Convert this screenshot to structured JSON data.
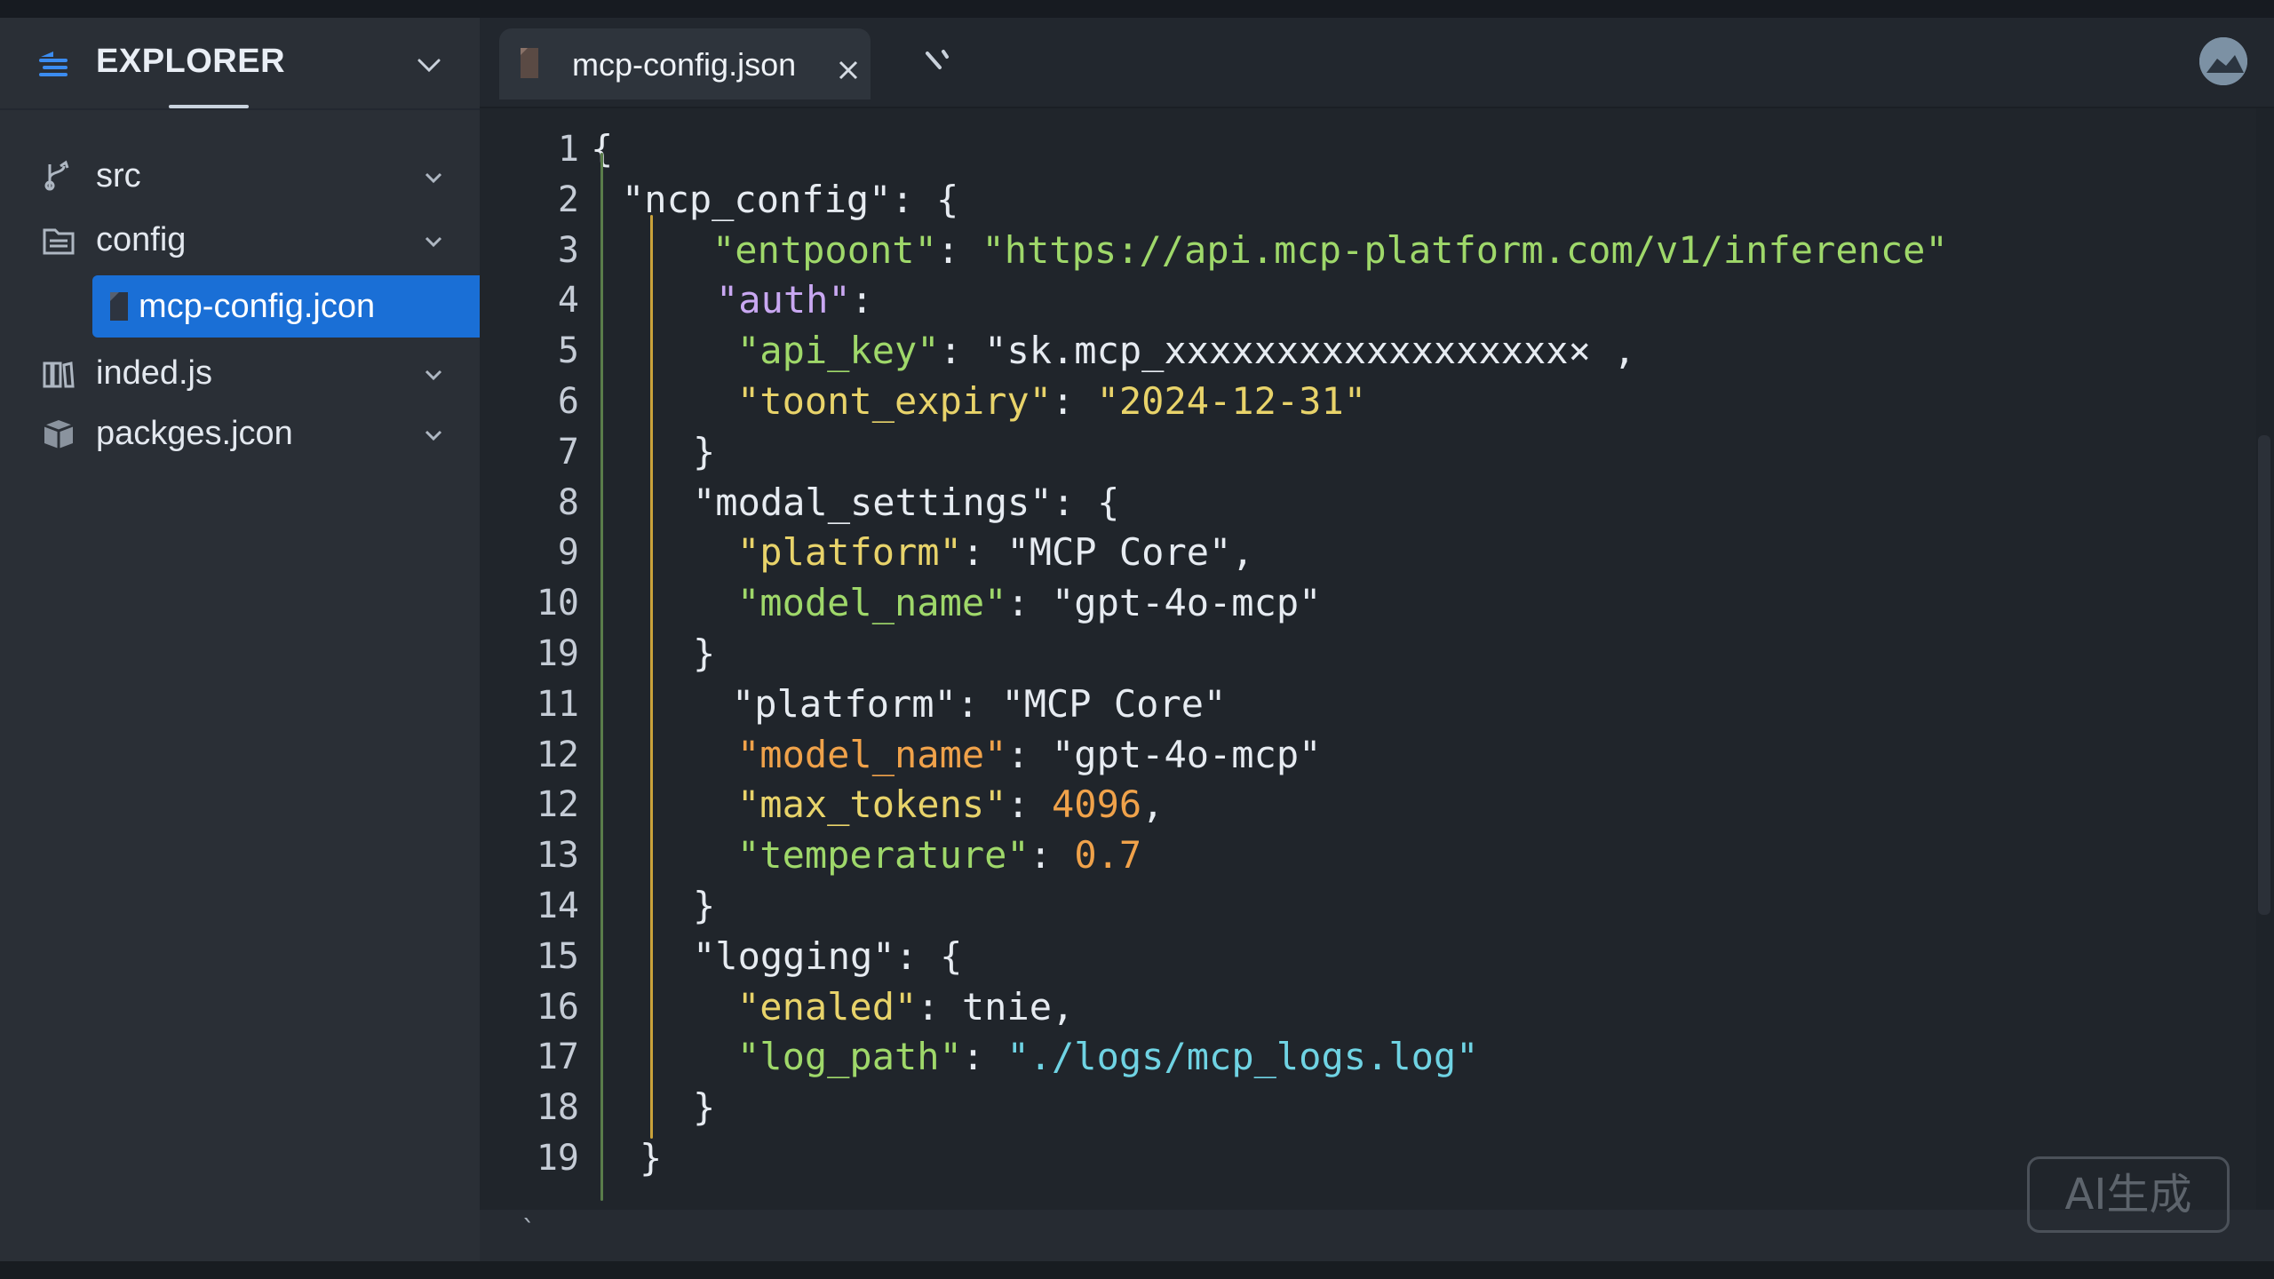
{
  "sidebar": {
    "title": "EXPLORER",
    "items": [
      {
        "label": "src",
        "icon": "git-branch-icon"
      },
      {
        "label": "config",
        "icon": "folder-icon"
      },
      {
        "label": "mcp-config.jcon",
        "icon": "file-icon",
        "active": true
      },
      {
        "label": "inded.js",
        "icon": "library-icon"
      },
      {
        "label": "packges.jcon",
        "icon": "package-icon"
      }
    ]
  },
  "tabs": [
    {
      "label": "mcp-config.json",
      "icon": "file-icon",
      "close": "close-icon"
    }
  ],
  "editor": {
    "line_numbers": [
      "1",
      "2",
      "3",
      "4",
      "5",
      "6",
      "7",
      "8",
      "9",
      "10",
      "19",
      "11",
      "12",
      "12",
      "13",
      "14",
      "15",
      "16",
      "17",
      "18",
      "19"
    ],
    "lines": [
      [
        "{"
      ],
      [
        "\"ncp_config\": {"
      ],
      [
        "\"entpoont\"",
        ": ",
        "\"https://api.mcp-platform.com/v1/inference\""
      ],
      [
        "\"auth\"",
        ":"
      ],
      [
        "\"api_key\"",
        ": ",
        "\"sk.mcp_xxxxxxxxxxxxxxxxxx× ,"
      ],
      [
        "\"toont_expiry\"",
        ": ",
        "\"2024-12-31\""
      ],
      [
        "}"
      ],
      [
        "\"modal_settings\": {"
      ],
      [
        "\"platform\"",
        ": ",
        "\"MCP Core\","
      ],
      [
        "\"model_name\"",
        ": ",
        "\"gpt-4o-mcp\""
      ],
      [
        "}"
      ],
      [
        "\"platform\"",
        ": ",
        "\"MCP Core\""
      ],
      [
        "\"model_name\"",
        ": ",
        "\"gpt-4o-mcp\""
      ],
      [
        "\"max_tokens\"",
        ": ",
        "4096",
        ","
      ],
      [
        "\"temperature\"",
        ": ",
        "0.7"
      ],
      [
        "}"
      ],
      [
        "\"logging\": {"
      ],
      [
        "\"enaled\"",
        ": ",
        "tnie,"
      ],
      [
        "\"log_path\"",
        ": ",
        "\"./logs/mcp_logs.log\""
      ],
      [
        "}"
      ],
      [
        "}"
      ]
    ]
  },
  "status": {
    "tick": "`"
  },
  "watermark": "AI生成",
  "colors": {
    "accent": "#1a6fd6",
    "key_green": "#9fd86a",
    "key_purple": "#c9a8f2",
    "string_yellow": "#e8d36a",
    "number_orange": "#f0a24a",
    "string_cyan": "#6fd3e3"
  }
}
